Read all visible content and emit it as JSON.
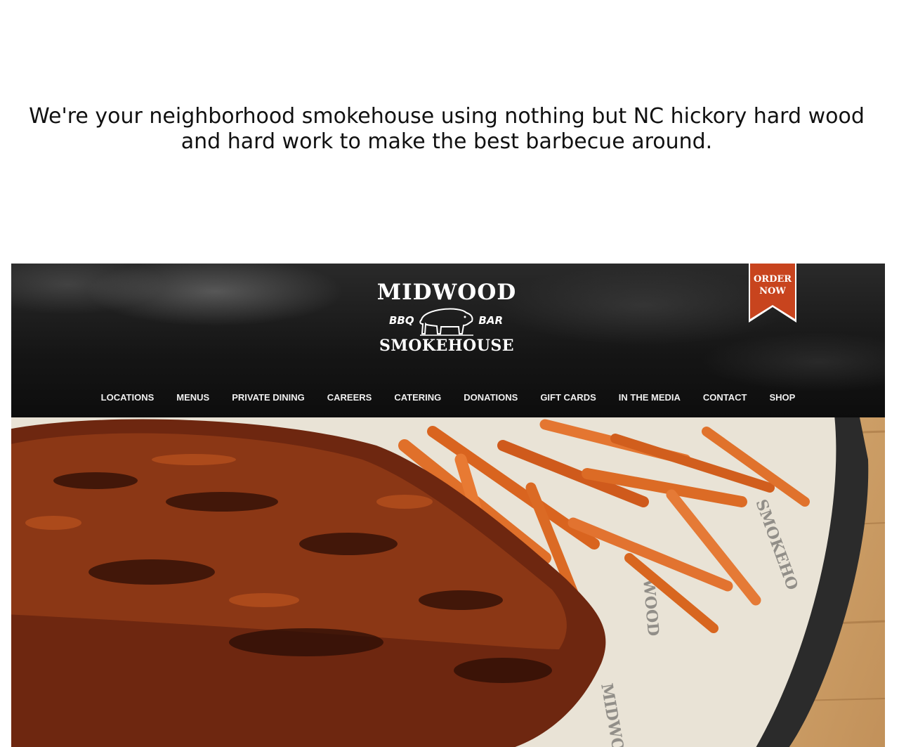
{
  "tagline": "We're your neighborhood smokehouse using nothing but NC hickory hard wood and hard work to make the best barbecue around.",
  "logo": {
    "top_word": "MIDWOOD",
    "left_word": "BBQ",
    "right_word": "BAR",
    "bottom_word": "SMOKEHOUSE",
    "icon": "pig-icon"
  },
  "order_badge": {
    "line1": "ORDER",
    "line2": "NOW",
    "color": "#c8441e"
  },
  "nav": {
    "items": [
      "LOCATIONS",
      "MENUS",
      "PRIVATE DINING",
      "CAREERS",
      "CATERING",
      "DONATIONS",
      "GIFT CARDS",
      "IN THE MEDIA",
      "CONTACT",
      "SHOP"
    ]
  },
  "hero": {
    "image": "ribs-and-sweet-potato-fries-photo"
  }
}
